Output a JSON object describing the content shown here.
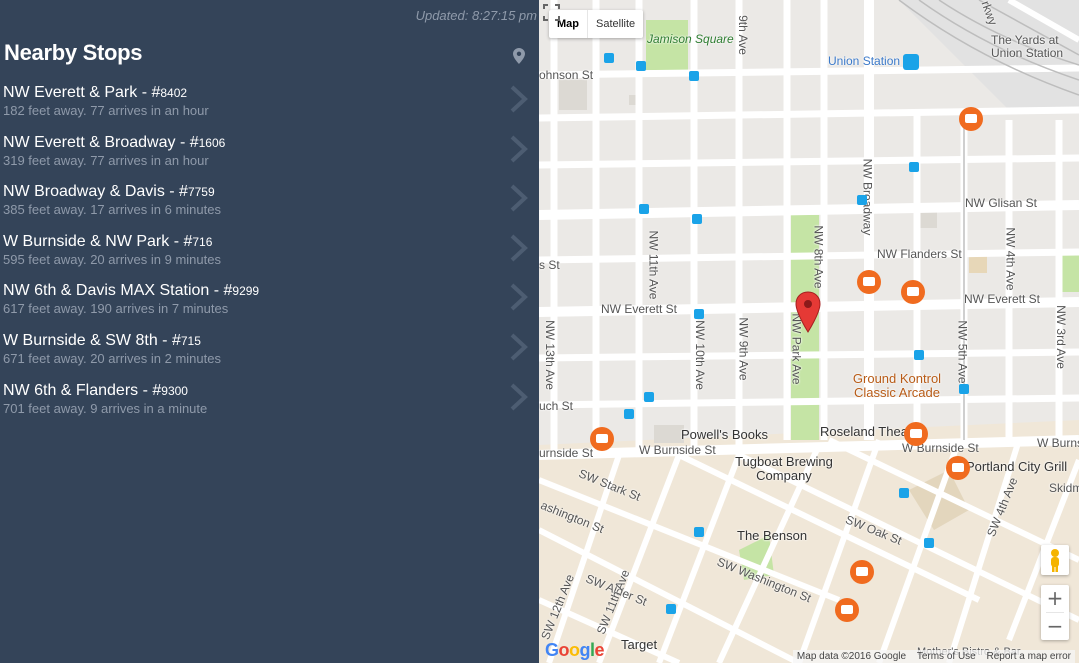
{
  "sidebar": {
    "updated": "Updated: 8:27:15 pm",
    "title": "Nearby Stops",
    "stops": [
      {
        "name": "NW Everett & Park - #",
        "num": "8402",
        "detail": "182 feet away. 77 arrives in an hour"
      },
      {
        "name": "NW Everett & Broadway - #",
        "num": "1606",
        "detail": "319 feet away. 77 arrives in an hour"
      },
      {
        "name": "NW Broadway & Davis - #",
        "num": "7759",
        "detail": "385 feet away. 17 arrives in 6 minutes"
      },
      {
        "name": "W Burnside & NW Park - #",
        "num": "716",
        "detail": "595 feet away. 20 arrives in 9 minutes"
      },
      {
        "name": "NW 6th & Davis MAX Station - #",
        "num": "9299",
        "detail": "617 feet away. 190 arrives in 7 minutes"
      },
      {
        "name": "W Burnside & SW 8th - #",
        "num": "715",
        "detail": "671 feet away. 20 arrives in 2 minutes"
      },
      {
        "name": "NW 6th & Flanders - #",
        "num": "9300",
        "detail": "701 feet away. 9 arrives in a minute"
      }
    ]
  },
  "map": {
    "type_map": "Map",
    "type_satellite": "Satellite",
    "zoom_in": "+",
    "zoom_out": "−",
    "logo": "Google",
    "attribution": {
      "data": "Map data ©2016 Google",
      "terms": "Terms of Use",
      "report": "Report a map error"
    },
    "labels": {
      "jamison": "Jamison Square",
      "johnson": "ohnson St",
      "union_station": "Union Station",
      "yards": "The Yards at Union Station",
      "glisan": "NW Glisan St",
      "flanders": "NW Flanders St",
      "everett_w": "NW Everett St",
      "everett_e": "NW Everett St",
      "davis": "s St",
      "couch": "uch St",
      "burnside_w": "W Burnside St",
      "burnside_sw": "urnside St",
      "burnside_c": "W Burnside St",
      "burnside_e": "W Burns",
      "stark": "SW Stark St",
      "ashington": "ashington St",
      "oak": "SW Oak St",
      "washington": "SW Washington St",
      "alder": "SW Alder St",
      "ave13": "NW 13th Ave",
      "ave11": "NW 11th Ave",
      "ave10": "NW 10th Ave",
      "ave9": "NW 9th Ave",
      "ave9_top": "9th Ave",
      "park": "NW Park Ave",
      "ave8": "NW 8th Ave",
      "broadway": "NW Broadway",
      "ave5": "NW 5th Ave",
      "ave4": "NW 4th Ave",
      "ave3": "NW 3rd Ave",
      "ave4_sw": "SW 4th Ave",
      "ave12_sw": "SW 12th Ave",
      "ave11_sw": "SW 11th Ave",
      "powells": "Powell's Books",
      "ground_kontrol": "Ground Kontrol Classic Arcade",
      "roseland": "Roseland Theater",
      "tugboat": "Tugboat Brewing Company",
      "portland_city_grill": "Portland City Grill",
      "benson": "The Benson",
      "target": "Target",
      "skidm": "Skidm",
      "parkway": "rkwy",
      "mothers": "Mother's Bistro & Bar"
    }
  },
  "colors": {
    "sidebar_bg": "#344459",
    "marker": "#e53935",
    "rail_icon": "#f06b1f",
    "bus_icon": "#1aa3e8"
  }
}
